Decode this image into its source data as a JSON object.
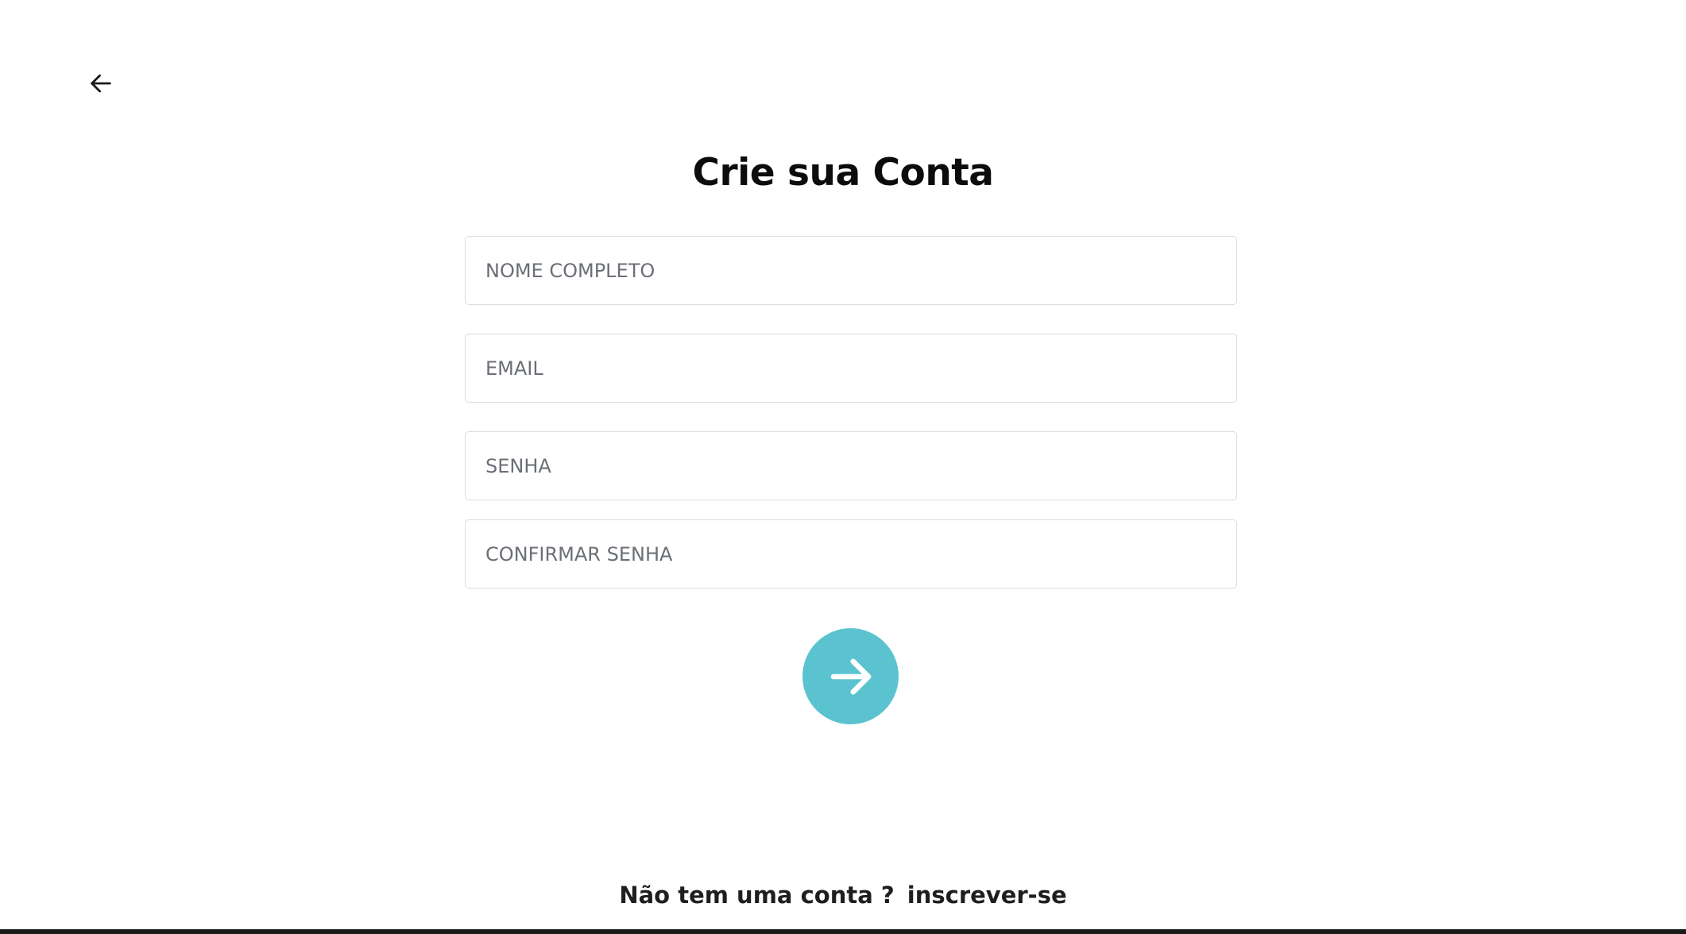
{
  "header": {
    "back_icon": "arrow-left-icon"
  },
  "form": {
    "title": "Crie sua Conta",
    "fields": {
      "full_name": {
        "placeholder": "NOME COMPLETO",
        "value": ""
      },
      "email": {
        "placeholder": "EMAIL",
        "value": ""
      },
      "password": {
        "placeholder": "SENHA",
        "value": ""
      },
      "confirm_password": {
        "placeholder": "CONFIRMAR SENHA",
        "value": ""
      }
    },
    "submit_icon": "arrow-right-icon"
  },
  "footer": {
    "prompt": "Não tem uma conta ?",
    "link": "inscrever-se"
  },
  "colors": {
    "accent": "#5bc3d0",
    "title": "#0c0c0c",
    "border": "#dcdcdc",
    "placeholder": "#6b6f76"
  }
}
